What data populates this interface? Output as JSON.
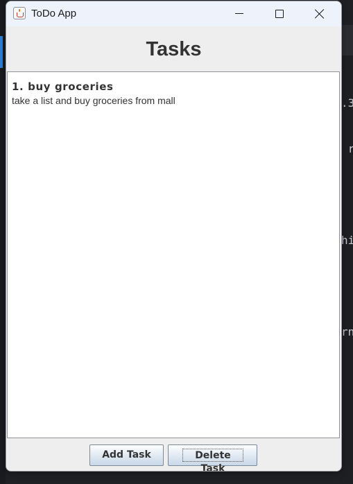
{
  "window": {
    "title": "ToDo App"
  },
  "header": {
    "title": "Tasks"
  },
  "tasks": [
    {
      "title": "1. buy groceries",
      "description": "take a list and buy groceries from mall"
    }
  ],
  "actions": {
    "add_label": "Add Task",
    "delete_label": "Delete Task"
  },
  "background_code": {
    "lines": [
      ".3",
      " r",
      "",
      "hi",
      "",
      "rn"
    ]
  },
  "colors": {
    "window_bg": "#eeeeee",
    "list_bg": "#ffffff",
    "titlebar_bg": "#eef3fb",
    "accent": "#2f7fd6"
  }
}
